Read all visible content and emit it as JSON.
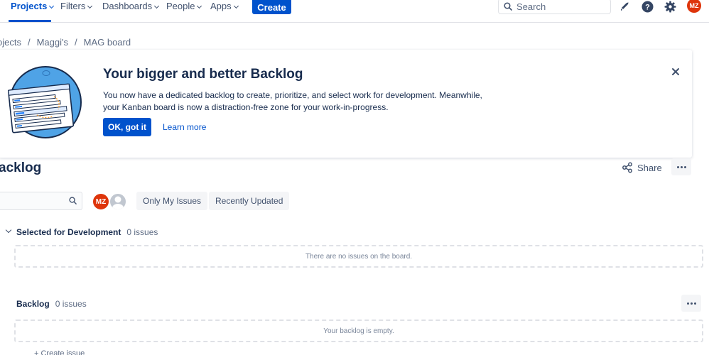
{
  "nav": {
    "items": [
      {
        "label": "Projects",
        "active": true
      },
      {
        "label": "Filters"
      },
      {
        "label": "Dashboards"
      },
      {
        "label": "People"
      },
      {
        "label": "Apps"
      }
    ],
    "create_label": "Create",
    "search_placeholder": "Search",
    "user_initials": "MZ",
    "icons": [
      "notification-icon",
      "help-icon",
      "settings-icon"
    ]
  },
  "breadcrumb": [
    "ojects",
    "Maggi's",
    "MAG board"
  ],
  "banner": {
    "title": "Your bigger and better Backlog",
    "description": "You now have a dedicated backlog to create, prioritize, and select work for development. Meanwhile, your Kanban board is now a distraction-free zone for your work-in-progress.",
    "ok_label": "OK, got it",
    "learn_more": "Learn more"
  },
  "page": {
    "title": "acklog",
    "share_label": "Share"
  },
  "filters": {
    "avatar_initials": "MZ",
    "quick_filters": [
      "Only My Issues",
      "Recently Updated"
    ]
  },
  "sections": {
    "selected": {
      "name": "Selected for Development",
      "count": "0 issues",
      "empty_text": "There are no issues on the board."
    },
    "backlog": {
      "name": "Backlog",
      "count": "0 issues",
      "empty_text": "Your backlog is empty."
    }
  },
  "create_issue_label": "+ Create issue",
  "colors": {
    "primary": "#0052cc",
    "avatar": "#de350b",
    "text": "#172b4d"
  }
}
